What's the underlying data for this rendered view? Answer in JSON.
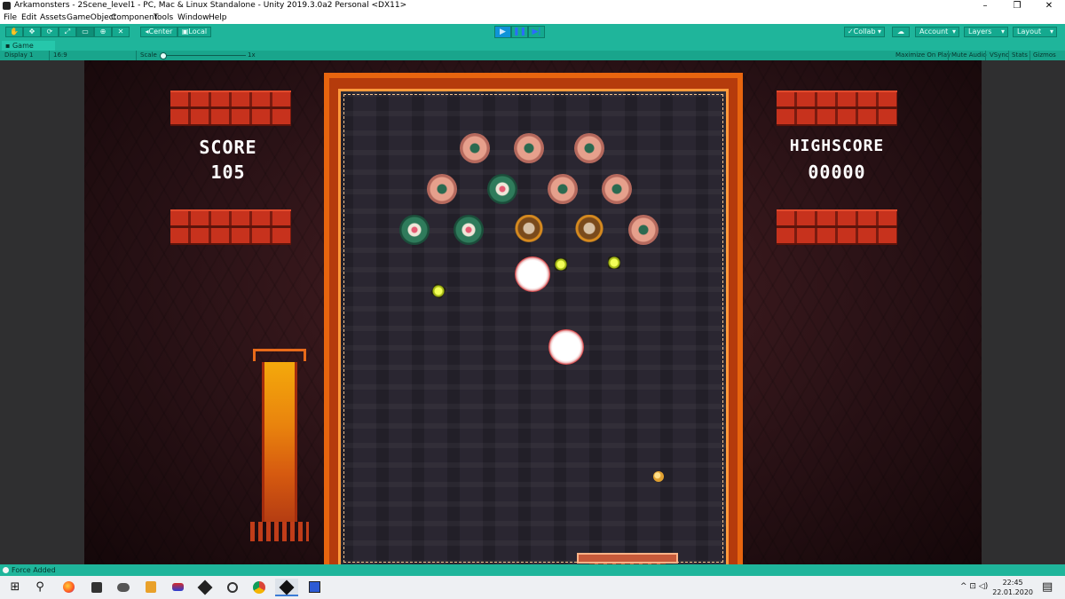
{
  "window": {
    "title": "Arkamonsters - 2Scene_level1 - PC, Mac & Linux Standalone - Unity 2019.3.0a2 Personal <DX11>",
    "controls": [
      "–",
      "❐",
      "✕"
    ]
  },
  "menu": [
    "File",
    "Edit",
    "Assets",
    "GameObject",
    "Component",
    "Tools",
    "Window",
    "Help"
  ],
  "toolbar": {
    "tools": [
      "✋",
      "✥",
      "⟳",
      "⤢",
      "▭",
      "⊕",
      "✕"
    ],
    "pivot_center": "◂Center",
    "pivot_local": "▣Local",
    "play": "▶",
    "pause": "❚❚",
    "step": "▶|",
    "collab": "✓Collab ▾",
    "cloud": "☁",
    "account": "Account",
    "layers": "Layers",
    "layout": "Layout",
    "dropdown": "▾"
  },
  "game_tab": {
    "label": "Game"
  },
  "game_bar": {
    "display": "Display 1",
    "aspect": "16:9",
    "scale_label": "Scale",
    "scale_value": "1x",
    "maximize": "Maximize On Play",
    "mute": "Mute Audio",
    "vsync": "VSync",
    "stats": "Stats",
    "gizmos": "Gizmos"
  },
  "hud": {
    "score_label": "SCORE",
    "score_value": "105",
    "highscore_label": "HIGHSCORE",
    "highscore_value": "00000"
  },
  "status": {
    "message": "Force Added"
  },
  "taskbar": {
    "start": "⊞",
    "search": "⚲",
    "apps": [
      "firefox",
      "twitch",
      "discord",
      "sublime",
      "game",
      "unity",
      "circle",
      "chrome",
      "unity-active",
      "editor"
    ],
    "tray": "^ ⊡ ◁)",
    "time": "22:45",
    "date": "22.01.2020",
    "notify": "▤"
  },
  "colors": {
    "unity_teal": "#1fb59b",
    "brick": "#c7321d",
    "arena_border": "#e8650f"
  }
}
